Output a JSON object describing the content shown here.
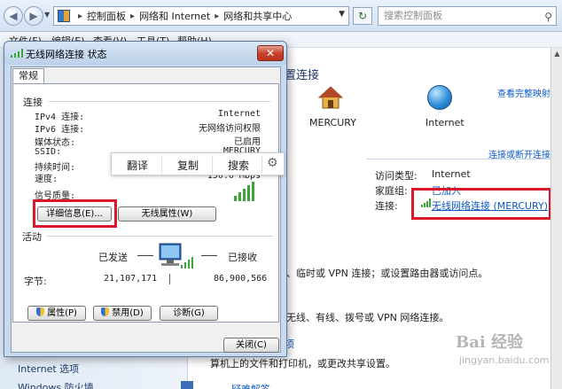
{
  "explorer": {
    "breadcrumb": [
      "控制面板",
      "网络和 Internet",
      "网络和共享中心"
    ],
    "search_placeholder": "搜索控制面板",
    "menu": [
      "文件(F)",
      "编辑(E)",
      "查看(V)",
      "工具(T)",
      "帮助(H)"
    ],
    "main_title": "置连接",
    "full_map_link": "查看完整映射",
    "map_nodes": [
      "MERCURY",
      "Internet"
    ],
    "connect_link": "连接或断开连接",
    "access_type_label": "访问类型:",
    "access_type_value": "Internet",
    "homegroup_label": "家庭组:",
    "homegroup_value": "已加入",
    "connection_label": "连接:",
    "connection_value": "无线网络连接 (MERCURY)",
    "body_lines": [
      "、临时或 VPN 连接；或设置路由器或访问点。",
      "无线、有线、拨号或 VPN 网络连接。",
      "算机上的文件和打印机，或更改共享设置。"
    ],
    "bottom_link": "项",
    "bottom_link2": "疑难解答",
    "left_links": [
      "Internet 选项",
      "Windows 防火墙"
    ],
    "watermark": "Bai 经验",
    "watermark_sub": "jingyan.baidu.com"
  },
  "dialog": {
    "title": "无线网络连接 状态",
    "tab": "常规",
    "connection_group": "连接",
    "rows": [
      {
        "label": "IPv4 连接:",
        "value": "Internet"
      },
      {
        "label": "IPv6 连接:",
        "value": "无网络访问权限"
      },
      {
        "label": "媒体状态:",
        "value": "已启用"
      },
      {
        "label": "SSID:",
        "value": "MERCURY"
      },
      {
        "label": "持续时间:",
        "value": ""
      },
      {
        "label": "速度:",
        "value": "150.0 Mbps"
      }
    ],
    "signal_quality_label": "信号质量:",
    "details_button": "详细信息(E)...",
    "wireless_props_button": "无线属性(W)",
    "activity_group": "活动",
    "sent_label": "已发送",
    "received_label": "已接收",
    "bytes_label": "字节:",
    "bytes_sent": "21,107,171",
    "bytes_received": "86,900,566",
    "properties_button": "属性(P)",
    "disable_button": "禁用(D)",
    "diagnose_button": "诊断(G)",
    "close_button": "关闭(C)"
  },
  "popup": {
    "items": [
      "翻译",
      "复制",
      "搜索"
    ]
  },
  "colors": {
    "highlight_box": "#d8182b",
    "link": "#0b57c4"
  }
}
